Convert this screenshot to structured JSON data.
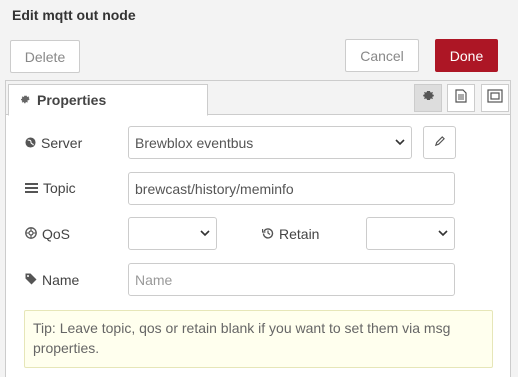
{
  "dialog": {
    "title": "Edit mqtt out node"
  },
  "toolbar": {
    "delete_label": "Delete",
    "cancel_label": "Cancel",
    "done_label": "Done"
  },
  "tabs": {
    "properties_label": "Properties",
    "icons": [
      "gear-icon",
      "description-icon",
      "appearance-icon"
    ]
  },
  "form": {
    "server": {
      "label": "Server",
      "value": "Brewblox eventbus"
    },
    "topic": {
      "label": "Topic",
      "value": "brewcast/history/meminfo"
    },
    "qos": {
      "label": "QoS",
      "value": ""
    },
    "retain": {
      "label": "Retain",
      "value": ""
    },
    "name": {
      "label": "Name",
      "placeholder": "Name",
      "value": ""
    }
  },
  "tip": {
    "text": "Tip: Leave topic, qos or retain blank if you want to set them via msg properties."
  },
  "colors": {
    "done": "#ad1625",
    "tip_bg": "#ffffee"
  }
}
